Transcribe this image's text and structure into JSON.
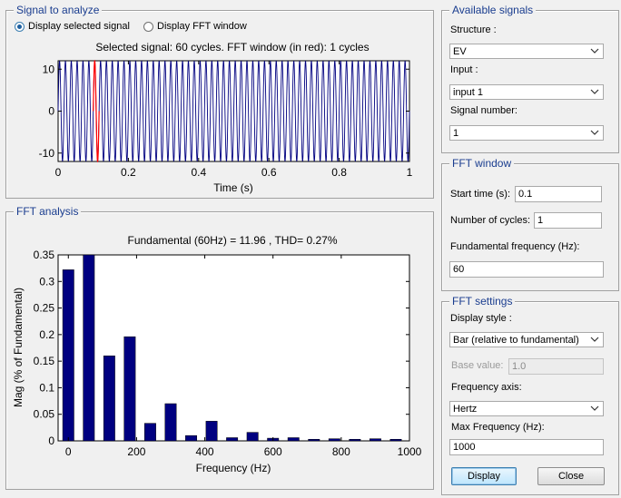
{
  "signal_panel": {
    "title": "Signal to analyze",
    "radio_selected_label": "Display selected signal",
    "radio_fft_label": "Display FFT window",
    "plot_title": "Selected signal: 60 cycles. FFT window (in red): 1 cycles",
    "xlabel": "Time (s)",
    "x_ticks": [
      "0",
      "0.2",
      "0.4",
      "0.6",
      "0.8",
      "1"
    ],
    "y_ticks": [
      "10",
      "0",
      "-10"
    ]
  },
  "fft_panel": {
    "title": "FFT analysis"
  },
  "available_signals": {
    "title": "Available signals",
    "structure_label": "Structure :",
    "structure_value": "EV",
    "input_label": "Input :",
    "input_value": "input 1",
    "signal_number_label": "Signal number:",
    "signal_number_value": "1"
  },
  "fft_window": {
    "title": "FFT window",
    "start_time_label": "Start time (s):",
    "start_time_value": "0.1",
    "cycles_label": "Number of cycles:",
    "cycles_value": "1",
    "fund_freq_label": "Fundamental frequency (Hz):",
    "fund_freq_value": "60"
  },
  "fft_settings": {
    "title": "FFT settings",
    "display_style_label": "Display style :",
    "display_style_value": "Bar (relative to fundamental)",
    "base_value_label": "Base value:",
    "base_value_value": "1.0",
    "freq_axis_label": "Frequency axis:",
    "freq_axis_value": "Hertz",
    "max_freq_label": "Max Frequency (Hz):",
    "max_freq_value": "1000"
  },
  "buttons": {
    "display": "Display",
    "close": "Close"
  },
  "colors": {
    "bar": "#000080",
    "signal": "#000080",
    "window": "#ff0000",
    "panel_title": "#1a3d8f"
  },
  "chart_data": [
    {
      "type": "line",
      "title": "Selected signal: 60 cycles. FFT window (in red): 1 cycles",
      "xlabel": "Time (s)",
      "ylabel": "",
      "xlim": [
        0,
        1
      ],
      "ylim": [
        -12,
        12
      ],
      "x_ticks": [
        0,
        0.2,
        0.4,
        0.6,
        0.8,
        1
      ],
      "y_ticks": [
        -10,
        0,
        10
      ],
      "series": [
        {
          "frequency_hz": 60,
          "amplitude": 11.96
        }
      ],
      "window": {
        "start": 0.1,
        "cycles": 1
      }
    },
    {
      "type": "bar",
      "title": "Fundamental (60Hz) = 11.96 , THD= 0.27%",
      "xlabel": "Frequency (Hz)",
      "ylabel": "Mag (% of Fundamental)",
      "xlim": [
        -30,
        1000
      ],
      "ylim": [
        0,
        0.35
      ],
      "x_ticks": [
        0,
        200,
        400,
        600,
        800,
        1000
      ],
      "y_ticks": [
        0,
        0.05,
        0.1,
        0.15,
        0.2,
        0.25,
        0.3,
        0.35
      ],
      "x": [
        0,
        60,
        120,
        180,
        240,
        300,
        360,
        420,
        480,
        540,
        600,
        660,
        720,
        780,
        840,
        900,
        960
      ],
      "values": [
        0.322,
        0.35,
        0.16,
        0.196,
        0.033,
        0.07,
        0.01,
        0.037,
        0.006,
        0.016,
        0.005,
        0.006,
        0.003,
        0.004,
        0.003,
        0.004,
        0.003
      ]
    }
  ]
}
